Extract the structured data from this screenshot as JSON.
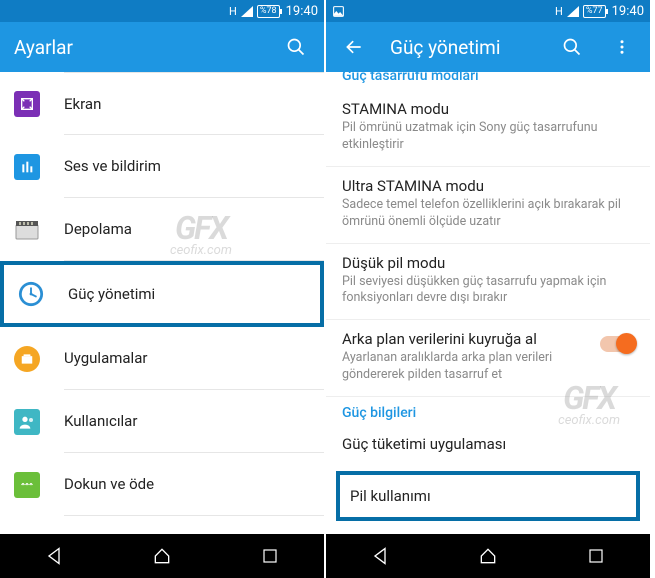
{
  "left": {
    "statusbar": {
      "signal": "H",
      "battery": "%78",
      "time": "19:40"
    },
    "appbar": {
      "title": "Ayarlar"
    },
    "rows": [
      {
        "name": "display",
        "label": "Ekran"
      },
      {
        "name": "sound",
        "label": "Ses ve bildirim"
      },
      {
        "name": "storage",
        "label": "Depolama"
      },
      {
        "name": "power",
        "label": "Güç yönetimi",
        "highlight": true
      },
      {
        "name": "apps",
        "label": "Uygulamalar"
      },
      {
        "name": "users",
        "label": "Kullanıcılar"
      },
      {
        "name": "nfc",
        "label": "Dokun ve öde"
      }
    ]
  },
  "right": {
    "statusbar": {
      "signal": "H",
      "battery": "%77",
      "time": "19:40"
    },
    "appbar": {
      "title": "Güç yönetimi"
    },
    "cutoff_header": "Güç tasarrufu modları",
    "items": [
      {
        "title": "STAMINA modu",
        "sub": "Pil ömrünü uzatmak için Sony güç tasarrufunu etkinleştirir"
      },
      {
        "title": "Ultra STAMINA modu",
        "sub": "Sadece temel telefon özelliklerini açık bırakarak pil ömrünü önemli ölçüde uzatır"
      },
      {
        "title": "Düşük pil modu",
        "sub": "Pil seviyesi düşükken güç tasarrufu yapmak için fonksiyonları devre dışı bırakır"
      }
    ],
    "queue": {
      "title": "Arka plan verilerini kuyruğa al",
      "sub": "Ayarlanan aralıklarda arka plan verileri göndererek pilden tasarruf et"
    },
    "section2": "Güç bilgileri",
    "consumption": "Güç tüketimi uygulaması",
    "battery_usage": "Pil kullanımı"
  },
  "watermark": {
    "brand": "GFX",
    "url": "ceofix.com"
  }
}
